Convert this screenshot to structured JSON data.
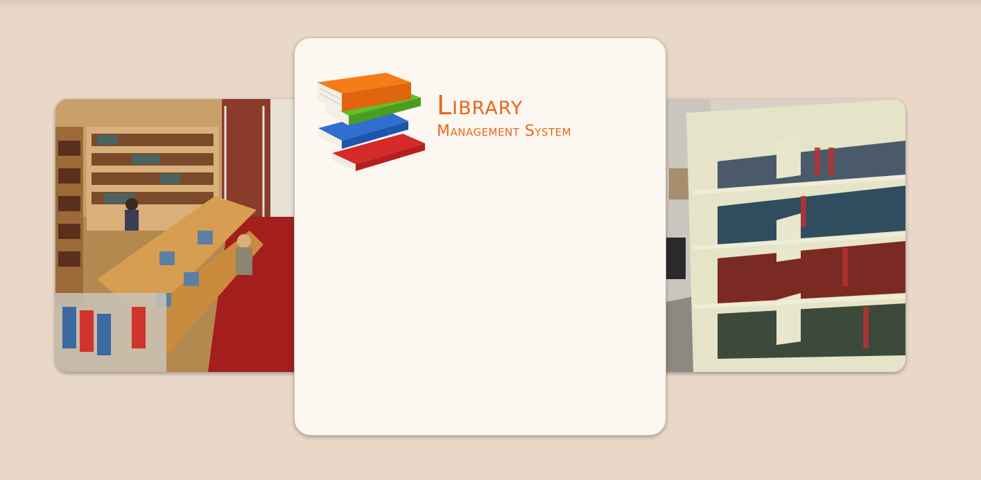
{
  "logo": {
    "title": "Library",
    "subtitle": "Management System",
    "icon": "stacked-books-icon"
  },
  "photos": {
    "left": "library-reading-room-photo",
    "right": "library-bookshelves-photo"
  },
  "colors": {
    "background": "#e9d7c8",
    "card": "#fdf7f1",
    "brand_orange": "#e8661a"
  }
}
